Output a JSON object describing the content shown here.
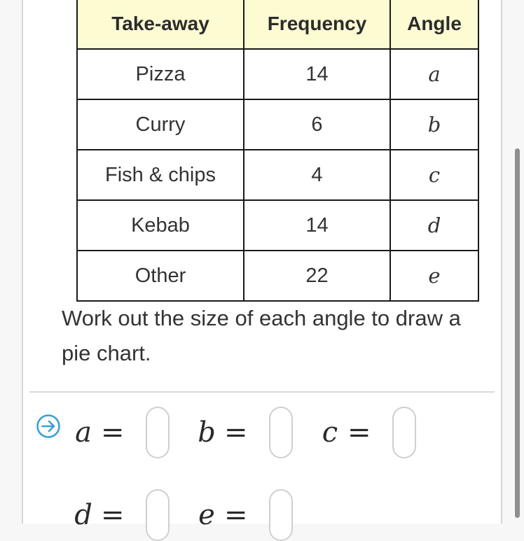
{
  "table": {
    "headers": [
      "Take-away",
      "Frequency",
      "Angle"
    ],
    "rows": [
      {
        "takeaway": "Pizza",
        "frequency": "14",
        "angle": "a"
      },
      {
        "takeaway": "Curry",
        "frequency": "6",
        "angle": "b"
      },
      {
        "takeaway": "Fish & chips",
        "frequency": "4",
        "angle": "c"
      },
      {
        "takeaway": "Kebab",
        "frequency": "14",
        "angle": "d"
      },
      {
        "takeaway": "Other",
        "frequency": "22",
        "angle": "e"
      }
    ]
  },
  "instruction": "Work out the size of each angle to draw a pie chart.",
  "answers": {
    "icon": "arrow-right-circle-icon",
    "accent_color": "#3a9fd6",
    "equals": "=",
    "fields": [
      {
        "variable": "a",
        "value": ""
      },
      {
        "variable": "b",
        "value": ""
      },
      {
        "variable": "c",
        "value": ""
      },
      {
        "variable": "d",
        "value": ""
      },
      {
        "variable": "e",
        "value": ""
      }
    ]
  }
}
